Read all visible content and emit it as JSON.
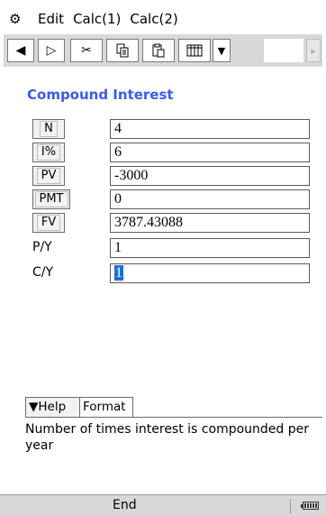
{
  "menu": {
    "icon": "gear-icon",
    "items": [
      "Edit",
      "Calc(1)",
      "Calc(2)"
    ]
  },
  "toolbar": {
    "buttons": [
      {
        "name": "back",
        "glyph": "◀"
      },
      {
        "name": "forward",
        "glyph": "▷"
      },
      {
        "name": "cut",
        "glyph": "✂"
      },
      {
        "name": "copy",
        "glyph": "⎘"
      },
      {
        "name": "paste",
        "glyph": "📋"
      },
      {
        "name": "table",
        "glyph": "▦"
      },
      {
        "name": "dropdown",
        "glyph": "▼"
      },
      {
        "name": "scroll-right",
        "glyph": "▸"
      }
    ]
  },
  "panel": {
    "title": "Compound Interest",
    "rows": [
      {
        "label": "N",
        "value": "4",
        "boxed": true
      },
      {
        "label": "I%",
        "value": "6",
        "boxed": true
      },
      {
        "label": "PV",
        "value": "-3000",
        "boxed": true
      },
      {
        "label": "PMT",
        "value": "0",
        "boxed": true
      },
      {
        "label": "FV",
        "value": "3787.43088",
        "boxed": true
      },
      {
        "label": "P/Y",
        "value": "1",
        "boxed": false
      },
      {
        "label": "C/Y",
        "value": "1",
        "boxed": false,
        "selected": true
      }
    ]
  },
  "help": {
    "tab_help": "▼Help",
    "tab_format": "Format",
    "text": "Number of times interest is compounded per year"
  },
  "status": {
    "text": "End",
    "icon": "battery-icon"
  },
  "colors": {
    "title": "#3b5ce6",
    "selection": "#1e6fd0",
    "toolbar_bg": "#d8d8d8",
    "frame": "#000000"
  }
}
